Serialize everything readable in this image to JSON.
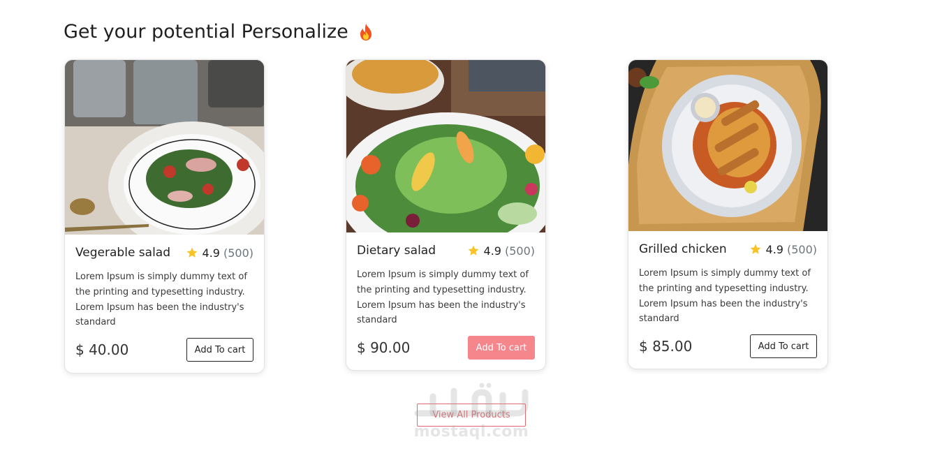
{
  "section": {
    "title": "Get your potential Personalize",
    "title_icon": "fire-icon"
  },
  "products": [
    {
      "name": "Vegerable salad",
      "rating": "4.9",
      "reviews": "(500)",
      "description": "Lorem Ipsum is simply dummy text of the printing and typesetting industry. Lorem Ipsum has been the industry's standard",
      "price": "$ 40.00",
      "button_label": "Add To cart"
    },
    {
      "name": "Dietary salad",
      "rating": "4.9",
      "reviews": "(500)",
      "description": "Lorem Ipsum is simply dummy text of the printing and typesetting industry. Lorem Ipsum has been the industry's standard",
      "price": "$ 90.00",
      "button_label": "Add To cart"
    },
    {
      "name": "Grilled chicken",
      "rating": "4.9",
      "reviews": "(500)",
      "description": "Lorem Ipsum is simply dummy text of the printing and typesetting industry. Lorem Ipsum has been the industry's standard",
      "price": "$ 85.00",
      "button_label": "Add To cart"
    }
  ],
  "view_all_label": "View All Products",
  "watermark": {
    "logo_text": "مستقل",
    "text": "mostaql.com"
  },
  "colors": {
    "accent": "#f4868c",
    "outline_accent": "#e0686f",
    "star": "#f7c325",
    "text": "#222222"
  }
}
